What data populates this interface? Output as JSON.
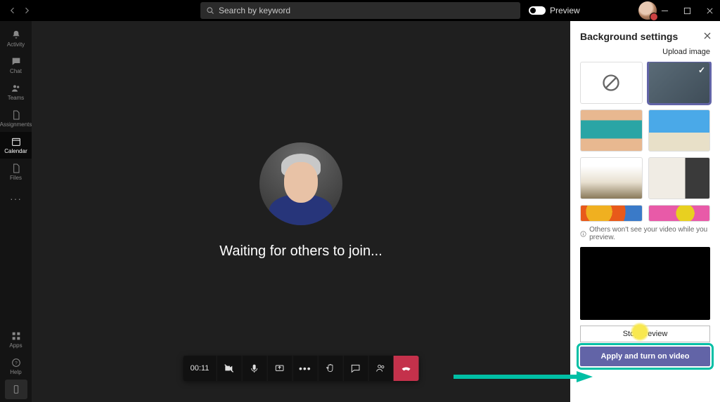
{
  "titlebar": {
    "search_placeholder": "Search by keyword",
    "preview_label": "Preview"
  },
  "rail": {
    "items": [
      {
        "label": "Activity"
      },
      {
        "label": "Chat"
      },
      {
        "label": "Teams"
      },
      {
        "label": "Assignments"
      },
      {
        "label": "Calendar"
      },
      {
        "label": "Files"
      }
    ],
    "more": "···",
    "apps": "Apps",
    "help": "Help"
  },
  "meeting": {
    "status_text": "Waiting for others to join...",
    "timer": "00:11"
  },
  "panel": {
    "title": "Background settings",
    "upload_label": "Upload image",
    "info_text": "Others won't see your video while you preview.",
    "stop_label": "Stop preview",
    "apply_label": "Apply and turn on video"
  }
}
